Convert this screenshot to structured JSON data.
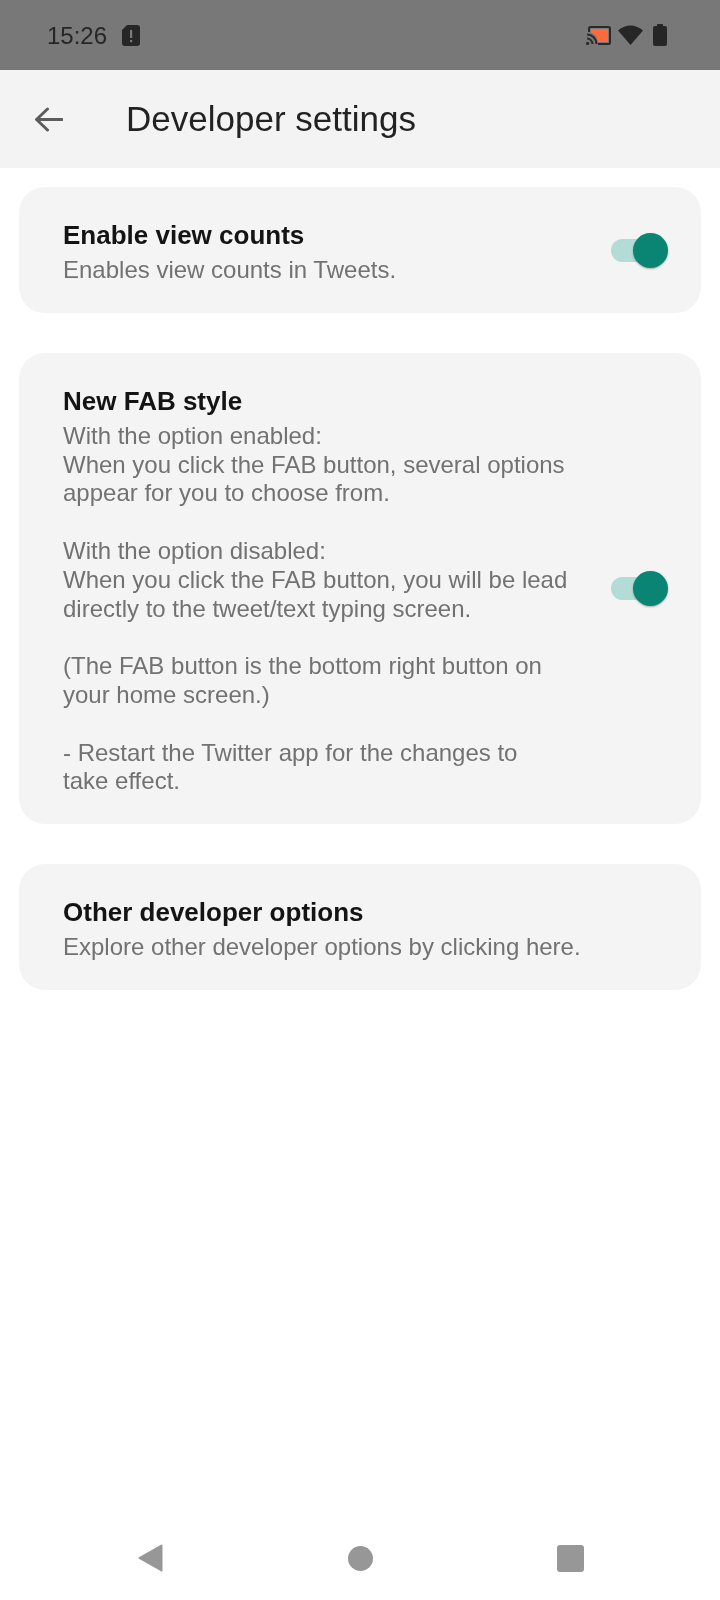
{
  "status_bar": {
    "time": "15:26"
  },
  "app_bar": {
    "title": "Developer settings"
  },
  "settings": [
    {
      "kind": "toggle",
      "title": "Enable view counts",
      "description": "Enables view counts in Tweets.",
      "on": true
    },
    {
      "kind": "toggle",
      "title": "New FAB style",
      "description": "With the option enabled:\nWhen you click the FAB button, several options appear for you to choose from.\n\nWith the option disabled:\nWhen you click the FAB button, you will be lead directly to the tweet/text typing screen.\n\n(The FAB button is the bottom right button on your home screen.)\n\n- Restart the Twitter app for the changes to take effect.",
      "on": true
    },
    {
      "kind": "link",
      "title": "Other developer options",
      "description": "Explore other developer options by clicking here."
    }
  ]
}
